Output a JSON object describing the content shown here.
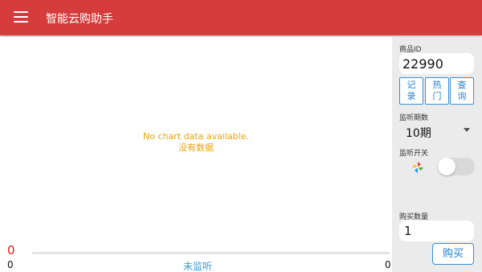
{
  "appbar": {
    "title": "智能云购助手",
    "color": "#d63c3c"
  },
  "chart": {
    "empty_line1": "No chart data available.",
    "empty_line2": "没有数据"
  },
  "side": {
    "product_id_label": "商品ID",
    "product_id_value": "22990",
    "buttons": [
      "记\n录",
      "热\n门",
      "查\n询"
    ],
    "period_label": "监听期数",
    "period_value": "10期",
    "monitor_label": "监听开关",
    "monitor_on": false,
    "qty_label": "购买数量",
    "qty_value": "1",
    "buy_label": "购买"
  },
  "bottom": {
    "count": "0",
    "min": "0",
    "max": "0",
    "status": "未监听",
    "progress": 0
  },
  "icons": {
    "menu": "hamburger-menu-icon",
    "pinwheel": "pinwheel-icon",
    "dropdown": "dropdown-arrow-icon"
  }
}
